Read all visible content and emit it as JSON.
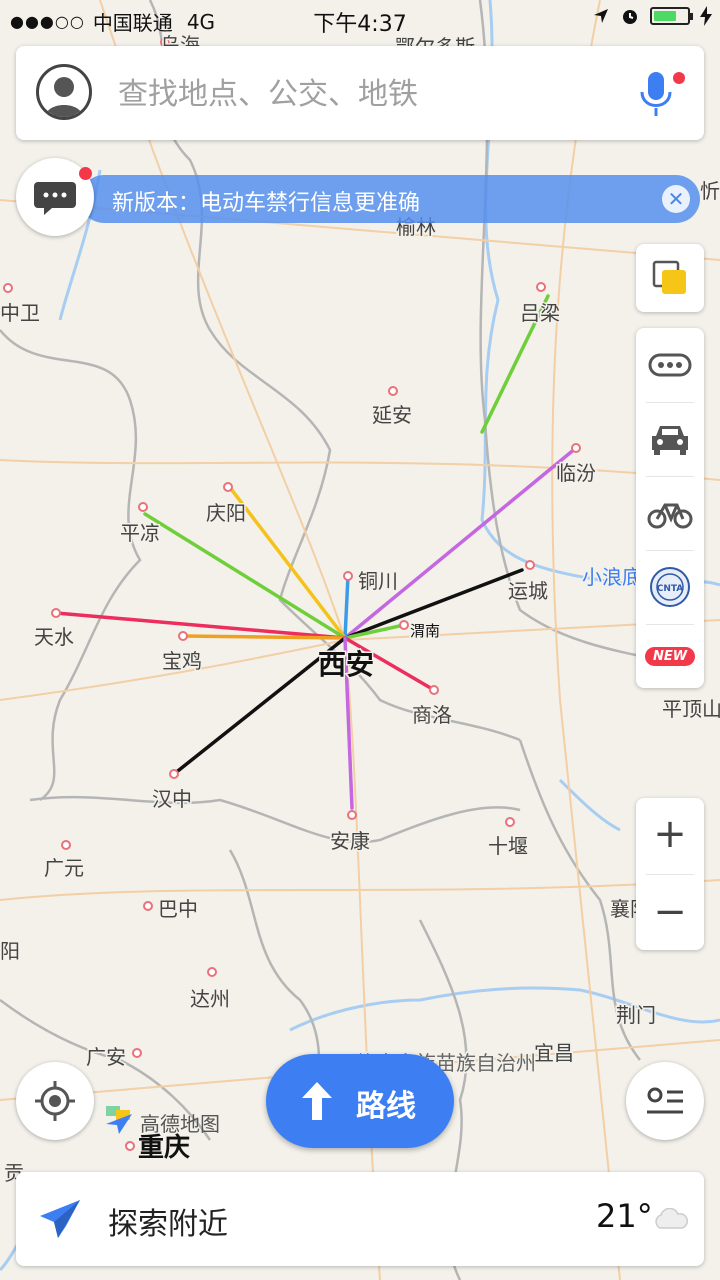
{
  "status_bar": {
    "carrier": "中国联通",
    "network": "4G",
    "time": "下午4:37",
    "battery_percent": 70
  },
  "search": {
    "placeholder": "查找地点、公交、地铁"
  },
  "notice": {
    "text": "新版本：电动车禁行信息更准确"
  },
  "side_panel": {
    "icons": [
      "layers-icon",
      "more-icon",
      "taxi-icon",
      "bike-icon",
      "cnta-icon",
      "new-feature-icon"
    ],
    "new_badge": "NEW",
    "cnta_label": "CNTA"
  },
  "zoom": {
    "in": "+",
    "out": "−"
  },
  "route_button": {
    "label": "路线"
  },
  "map_logo": "高德地图",
  "bottom_bar": {
    "explore_label": "探索附近",
    "temperature": "21°"
  },
  "map": {
    "center_city": "西安",
    "cities": [
      {
        "name": "乌海"
      },
      {
        "name": "鄂尔多斯"
      },
      {
        "name": "忻"
      },
      {
        "name": "榆林"
      },
      {
        "name": "中卫"
      },
      {
        "name": "吕梁"
      },
      {
        "name": "延安"
      },
      {
        "name": "临汾"
      },
      {
        "name": "庆阳"
      },
      {
        "name": "平凉"
      },
      {
        "name": "铜川"
      },
      {
        "name": "运城"
      },
      {
        "name": "小浪底"
      },
      {
        "name": "天水"
      },
      {
        "name": "渭南"
      },
      {
        "name": "宝鸡"
      },
      {
        "name": "西安"
      },
      {
        "name": "商洛"
      },
      {
        "name": "平顶山"
      },
      {
        "name": "汉中"
      },
      {
        "name": "安康"
      },
      {
        "name": "十堰"
      },
      {
        "name": "广元"
      },
      {
        "name": "巴中"
      },
      {
        "name": "襄阳"
      },
      {
        "name": "阳"
      },
      {
        "name": "达州"
      },
      {
        "name": "荆门"
      },
      {
        "name": "广安"
      },
      {
        "name": "宜昌"
      },
      {
        "name": "重庆"
      },
      {
        "name": "贡"
      },
      {
        "name": "恩施土家族苗族自治州"
      }
    ],
    "routes": [
      {
        "to": "吕梁",
        "color": "#6fcf3a"
      },
      {
        "to": "临汾",
        "color": "#c467e0"
      },
      {
        "to": "运城",
        "color": "#111111"
      },
      {
        "to": "渭南",
        "color": "#6fcf3a"
      },
      {
        "to": "铜川",
        "color": "#3a9be8"
      },
      {
        "to": "庆阳",
        "color": "#f5c21b"
      },
      {
        "to": "平凉",
        "color": "#6fcf3a"
      },
      {
        "to": "天水",
        "color": "#ec2d5e"
      },
      {
        "to": "宝鸡",
        "color": "#f0a020"
      },
      {
        "to": "商洛",
        "color": "#ec2d5e"
      },
      {
        "to": "汉中",
        "color": "#111111"
      },
      {
        "to": "安康",
        "color": "#c467e0"
      }
    ]
  },
  "colors": {
    "accent": "#3d7ff2",
    "notice_bg": "#5089f0",
    "alert_red": "#f2394a",
    "river": "#a7cdf2",
    "border": "#b5b5b5",
    "road": "#f3cfa5"
  }
}
